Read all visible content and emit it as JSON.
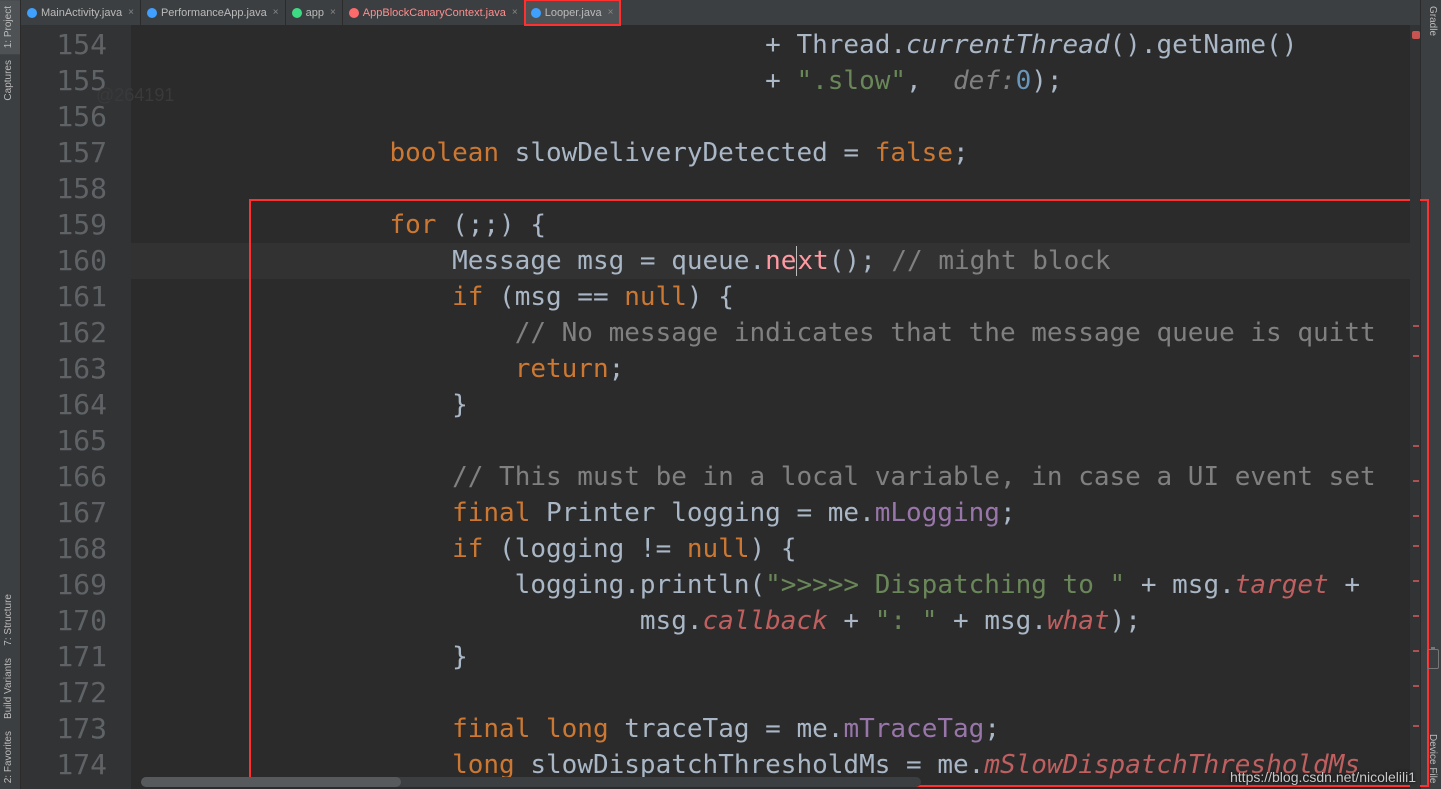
{
  "tabs": [
    {
      "label": "MainActivity.java",
      "iconClass": "ic-blue"
    },
    {
      "label": "PerformanceApp.java",
      "iconClass": "ic-blue"
    },
    {
      "label": "app",
      "iconClass": "ic-green"
    },
    {
      "label": "AppBlockCanaryContext.java",
      "iconClass": "ic-red",
      "nameRed": true
    },
    {
      "label": "Looper.java",
      "iconClass": "ic-blue",
      "active": true,
      "highlighted": true
    }
  ],
  "leftTabs": [
    "1: Project",
    "Captures",
    "7: Structure",
    "Build Variants",
    "2: Favorites"
  ],
  "rightTabs": [
    "Gradle",
    "Device File"
  ],
  "embedded": "@264191",
  "lineStart": 154,
  "lineEnd": 174,
  "code": {
    "l154": [
      {
        "text": "                                        + Thread.",
        "cls": "plain"
      },
      {
        "text": "currentThread",
        "cls": "method-call italic"
      },
      {
        "text": "().getName()",
        "cls": "plain"
      }
    ],
    "l155": [
      {
        "text": "                                        + ",
        "cls": "plain"
      },
      {
        "text": "\".slow\"",
        "cls": "str"
      },
      {
        "text": ",  ",
        "cls": "plain"
      },
      {
        "text": "def:",
        "cls": "paramname"
      },
      {
        "text": "0",
        "cls": "num"
      },
      {
        "text": ");",
        "cls": "plain"
      }
    ],
    "l156": [],
    "l157": [
      {
        "text": "                ",
        "cls": "plain"
      },
      {
        "text": "boolean",
        "cls": "kw"
      },
      {
        "text": " slowDeliveryDetected = ",
        "cls": "plain"
      },
      {
        "text": "false",
        "cls": "kw"
      },
      {
        "text": ";",
        "cls": "plain"
      }
    ],
    "l158": [],
    "l159": [
      {
        "text": "                ",
        "cls": "plain"
      },
      {
        "text": "for",
        "cls": "kw"
      },
      {
        "text": " (;;) {",
        "cls": "plain"
      }
    ],
    "l160": [
      {
        "text": "                    Message msg = queue.",
        "cls": "plain"
      },
      {
        "text": "ne",
        "cls": "method-call pink"
      },
      {
        "text": "",
        "cls": "caret"
      },
      {
        "text": "xt",
        "cls": "method-call pink"
      },
      {
        "text": "(); ",
        "cls": "plain"
      },
      {
        "text": "// might block",
        "cls": "cmt"
      }
    ],
    "l161": [
      {
        "text": "                    ",
        "cls": "plain"
      },
      {
        "text": "if",
        "cls": "kw"
      },
      {
        "text": " (msg == ",
        "cls": "plain"
      },
      {
        "text": "null",
        "cls": "kw"
      },
      {
        "text": ") {",
        "cls": "plain"
      }
    ],
    "l162": [
      {
        "text": "                        ",
        "cls": "plain"
      },
      {
        "text": "// No message indicates that the message queue is quitt",
        "cls": "cmt"
      }
    ],
    "l163": [
      {
        "text": "                        ",
        "cls": "plain"
      },
      {
        "text": "return",
        "cls": "kw"
      },
      {
        "text": ";",
        "cls": "plain"
      }
    ],
    "l164": [
      {
        "text": "                    }",
        "cls": "plain"
      }
    ],
    "l165": [],
    "l166": [
      {
        "text": "                    ",
        "cls": "plain"
      },
      {
        "text": "// This must be in a local variable, in case a UI event set",
        "cls": "cmt"
      }
    ],
    "l167": [
      {
        "text": "                    ",
        "cls": "plain"
      },
      {
        "text": "final",
        "cls": "kw"
      },
      {
        "text": " Printer logging = me.",
        "cls": "plain"
      },
      {
        "text": "mLogging",
        "cls": "field"
      },
      {
        "text": ";",
        "cls": "plain"
      }
    ],
    "l168": [
      {
        "text": "                    ",
        "cls": "plain"
      },
      {
        "text": "if",
        "cls": "kw"
      },
      {
        "text": " (logging != ",
        "cls": "plain"
      },
      {
        "text": "null",
        "cls": "kw"
      },
      {
        "text": ") {",
        "cls": "plain"
      }
    ],
    "l169": [
      {
        "text": "                        logging.println(",
        "cls": "plain"
      },
      {
        "text": "\">>>>> Dispatching to \"",
        "cls": "str"
      },
      {
        "text": " + msg.",
        "cls": "plain"
      },
      {
        "text": "target",
        "cls": "field red"
      },
      {
        "text": " + ",
        "cls": "plain"
      }
    ],
    "l170": [
      {
        "text": "                                msg.",
        "cls": "plain"
      },
      {
        "text": "callback",
        "cls": "field red"
      },
      {
        "text": " + ",
        "cls": "plain"
      },
      {
        "text": "\": \"",
        "cls": "str"
      },
      {
        "text": " + msg.",
        "cls": "plain"
      },
      {
        "text": "what",
        "cls": "field red"
      },
      {
        "text": ");",
        "cls": "plain"
      }
    ],
    "l171": [
      {
        "text": "                    }",
        "cls": "plain"
      }
    ],
    "l172": [],
    "l173": [
      {
        "text": "                    ",
        "cls": "plain"
      },
      {
        "text": "final long",
        "cls": "kw"
      },
      {
        "text": " traceTag = me.",
        "cls": "plain"
      },
      {
        "text": "mTraceTag",
        "cls": "field"
      },
      {
        "text": ";",
        "cls": "plain"
      }
    ],
    "l174": [
      {
        "text": "                    ",
        "cls": "plain"
      },
      {
        "text": "long",
        "cls": "kw"
      },
      {
        "text": " slowDispatchThresholdMs = me.",
        "cls": "plain"
      },
      {
        "text": "mSlowDispatchThresholdMs",
        "cls": "field red"
      }
    ]
  },
  "watermark": "https://blog.csdn.net/nicolelili1"
}
